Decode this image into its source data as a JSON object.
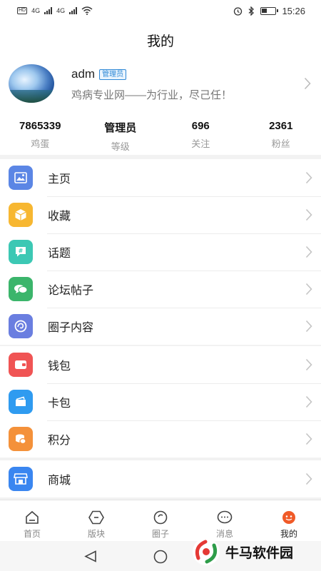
{
  "status_bar": {
    "left": [
      "HD",
      "4G",
      "4G"
    ],
    "time": "15:26"
  },
  "header": {
    "title": "我的"
  },
  "profile": {
    "username": "adm",
    "role_badge": "管理员",
    "signature": "鸡病专业网——为行业，尽己任！"
  },
  "stats": [
    {
      "value": "7865339",
      "label": "鸡蛋"
    },
    {
      "value": "管理员",
      "label": "等级"
    },
    {
      "value": "696",
      "label": "关注"
    },
    {
      "value": "2361",
      "label": "粉丝"
    }
  ],
  "menu": {
    "group1": [
      {
        "label": "主页",
        "icon": "image-icon",
        "color": "#5b86e5"
      },
      {
        "label": "收藏",
        "icon": "box-icon",
        "color": "#f7b731"
      },
      {
        "label": "话题",
        "icon": "hashtag-icon",
        "color": "#3cc8b4"
      },
      {
        "label": "论坛帖子",
        "icon": "chat-bubbles-icon",
        "color": "#3bb56b"
      },
      {
        "label": "圈子内容",
        "icon": "circle-swirl-icon",
        "color": "#6a7ee0"
      }
    ],
    "group2": [
      {
        "label": "钱包",
        "icon": "wallet-icon",
        "color": "#f05454"
      },
      {
        "label": "卡包",
        "icon": "card-holder-icon",
        "color": "#2f9bf0"
      },
      {
        "label": "积分",
        "icon": "coins-icon",
        "color": "#f4913a"
      }
    ],
    "group3": [
      {
        "label": "商城",
        "icon": "store-icon",
        "color": "#3a86f0"
      }
    ]
  },
  "tabs": [
    {
      "label": "首页",
      "icon": "home-icon"
    },
    {
      "label": "版块",
      "icon": "hexagon-icon"
    },
    {
      "label": "圈子",
      "icon": "circle-icon"
    },
    {
      "label": "消息",
      "icon": "message-icon"
    },
    {
      "label": "我的",
      "icon": "face-icon",
      "active": true
    }
  ],
  "watermark": {
    "text": "牛马软件园"
  },
  "colors": {
    "accent": "#f05a28",
    "badge": "#2e88d6"
  }
}
